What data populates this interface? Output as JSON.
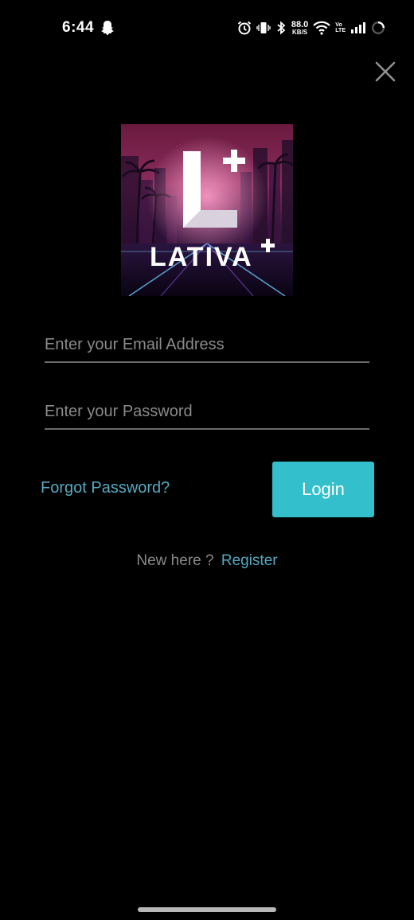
{
  "status_bar": {
    "time": "6:44",
    "network_speed": "88.0",
    "network_speed_unit": "KB/S",
    "volte_top": "Vo",
    "volte_bottom": "LTE"
  },
  "logo": {
    "text": "LATIVA"
  },
  "login_form": {
    "email_placeholder": "Enter your Email Address",
    "password_placeholder": "Enter your Password",
    "forgot_password": "Forgot Password?",
    "login_button": "Login",
    "new_here": "New here ?",
    "register": "Register"
  },
  "colors": {
    "accent": "#33c0cc",
    "link": "#55a9bf",
    "background": "#000000"
  }
}
